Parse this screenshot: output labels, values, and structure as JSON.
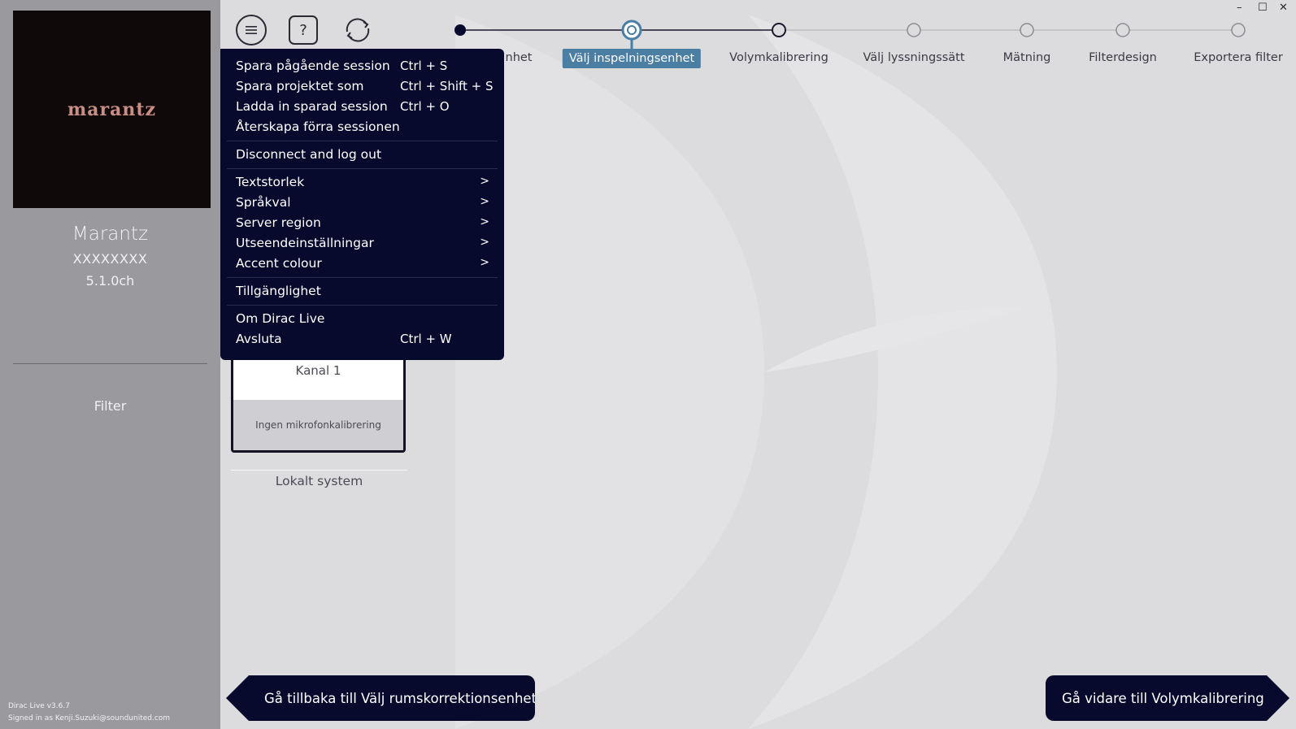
{
  "sidebar": {
    "logo_text": "marantz",
    "device_name": "Marantz",
    "device_serial": "XXXXXXXX",
    "channels": "5.1.0ch",
    "filter_label": "Filter",
    "version": "Dirac Live v3.6.7",
    "signed_in": "Signed in as Kenji.Suzuki@soundunited.com"
  },
  "toolbar": {
    "menu_icon": "hamburger-menu-icon",
    "help_label": "?",
    "help_icon": "help-icon",
    "refresh_icon": "refresh-icon"
  },
  "stepper": {
    "current_step_index": 1,
    "steps": [
      {
        "label": "nhet",
        "state": "done"
      },
      {
        "label": "Välj inspelningsenhet",
        "state": "current"
      },
      {
        "label": "Volymkalibrering",
        "state": "next"
      },
      {
        "label": "Välj lyssningssätt",
        "state": "pending"
      },
      {
        "label": "Mätning",
        "state": "pending"
      },
      {
        "label": "Filterdesign",
        "state": "pending"
      },
      {
        "label": "Exportera filter",
        "state": "pending"
      }
    ]
  },
  "main_menu": {
    "items": [
      {
        "label": "Spara pågående session",
        "shortcut": "Ctrl + S"
      },
      {
        "label": "Spara projektet som",
        "shortcut": "Ctrl + Shift + S"
      },
      {
        "label": "Ladda in sparad session",
        "shortcut": "Ctrl + O"
      },
      {
        "label": "Återskapa förra sessionen"
      },
      {
        "label": "Disconnect and log out"
      },
      {
        "label": "Textstorlek",
        "arrow": ">"
      },
      {
        "label": "Språkval",
        "arrow": ">"
      },
      {
        "label": "Server region",
        "arrow": ">"
      },
      {
        "label": "Utseendeinställningar",
        "arrow": ">"
      },
      {
        "label": "Accent colour",
        "arrow": ">"
      },
      {
        "label": "Tillgänglighet"
      },
      {
        "label": "Om Dirac Live"
      },
      {
        "label": "Avsluta",
        "shortcut": "Ctrl + W"
      }
    ]
  },
  "recording_device": {
    "channel": "Kanal 1",
    "calibration": "Ingen mikrofonkalibrering",
    "system": "Lokalt system"
  },
  "navigation": {
    "back": "Gå tillbaka till Välj rumskorrektionsenhet",
    "next": "Gå vidare till Volymkalibrering"
  },
  "window": {
    "minimize": "–",
    "maximize": "☐",
    "close": "✕"
  },
  "colors": {
    "accent": "#4a7ea3",
    "menu_bg": "#070a2c",
    "sidebar_bg": "#9a999e",
    "main_bg": "#dcdbde"
  }
}
